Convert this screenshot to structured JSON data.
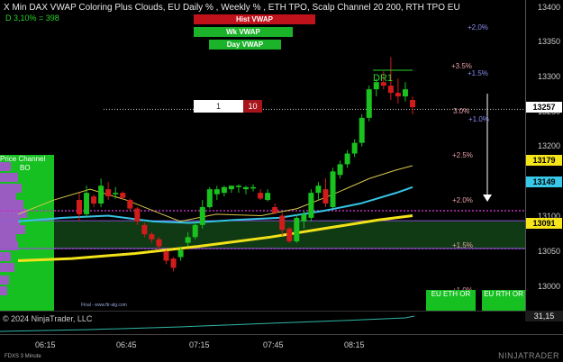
{
  "header": {
    "title": "X Min DAX VWAP Coloring Plus Clouds, EU Daily % , Weekly % , ETH TPO, Scalp Channel 20  200, RTH TPO EU",
    "d_line": "D 3,10% = 398"
  },
  "vwap_buttons": {
    "hist": "Hist VWAP",
    "wk": "Wk VWAP",
    "day": "Day VWAP"
  },
  "percent_labels": [
    {
      "text": "+2,0%",
      "color": "blue"
    },
    {
      "text": "+3.5%",
      "color": "pink"
    },
    {
      "text": "+1.5%",
      "color": "blue"
    },
    {
      "text": "3.0%",
      "color": "pink"
    },
    {
      "text": "+1.0%",
      "color": "blue"
    },
    {
      "text": "+2.5%",
      "color": "pink"
    },
    {
      "text": "+2.0%",
      "color": "pink"
    },
    {
      "text": "+1.5%",
      "color": "pink"
    },
    {
      "text": "+1.0%",
      "color": "pink"
    }
  ],
  "order": {
    "quantity": "1",
    "price_offset": "10"
  },
  "volume_profile": {
    "label": "Price Channel",
    "sub": "BO"
  },
  "dr_label": "DR1",
  "eu_or": {
    "eth": "EU ETH OR",
    "rth": "EU RTH OR"
  },
  "copyright": "Final - www.ftr-alg.com",
  "price_axis": {
    "ticks": [
      "13400",
      "13350",
      "13300",
      "13250",
      "13200",
      "13150",
      "13100",
      "13050",
      "13000"
    ],
    "tags": [
      {
        "text": "13257",
        "bg": "#ffffff"
      },
      {
        "text": "13179",
        "bg": "#f5e51a"
      },
      {
        "text": "13149",
        "bg": "#39c9e8"
      },
      {
        "text": "13091",
        "bg": "#f5e51a"
      }
    ]
  },
  "oscillator": {
    "label": "© 2024 NinjaTrader, LLC",
    "value": "31,15"
  },
  "time_axis": [
    "06:15",
    "06:45",
    "07:15",
    "07:45",
    "08:15"
  ],
  "footer": {
    "instrument": "FDXS 3 Minute",
    "logo": "NINJATRADER"
  },
  "colors": {
    "up": "#19c21e",
    "down": "#d21c1c",
    "yellow": "#f2e21a",
    "cyan": "#35c4e6",
    "magenta": "#c030c0",
    "cloud": "#0f3a14"
  },
  "chart_data": {
    "type": "candlestick",
    "ylim": [
      12975,
      13410
    ],
    "candles": [
      {
        "o": 13130,
        "h": 13140,
        "l": 13100,
        "c": 13110
      },
      {
        "o": 13110,
        "h": 13150,
        "l": 13105,
        "c": 13140
      },
      {
        "o": 13135,
        "h": 13138,
        "l": 13120,
        "c": 13125
      },
      {
        "o": 13125,
        "h": 13160,
        "l": 13120,
        "c": 13150
      },
      {
        "o": 13145,
        "h": 13155,
        "l": 13130,
        "c": 13135
      },
      {
        "o": 13138,
        "h": 13148,
        "l": 13132,
        "c": 13140
      },
      {
        "o": 13140,
        "h": 13142,
        "l": 13130,
        "c": 13133
      },
      {
        "o": 13130,
        "h": 13132,
        "l": 13115,
        "c": 13118
      },
      {
        "o": 13118,
        "h": 13120,
        "l": 13095,
        "c": 13100
      },
      {
        "o": 13095,
        "h": 13098,
        "l": 13078,
        "c": 13082
      },
      {
        "o": 13082,
        "h": 13085,
        "l": 13070,
        "c": 13075
      },
      {
        "o": 13075,
        "h": 13078,
        "l": 13060,
        "c": 13065
      },
      {
        "o": 13058,
        "h": 13060,
        "l": 13040,
        "c": 13045
      },
      {
        "o": 13048,
        "h": 13050,
        "l": 13030,
        "c": 13035
      },
      {
        "o": 13050,
        "h": 13065,
        "l": 13045,
        "c": 13060
      },
      {
        "o": 13070,
        "h": 13085,
        "l": 13065,
        "c": 13078
      },
      {
        "o": 13078,
        "h": 13100,
        "l": 13075,
        "c": 13095
      },
      {
        "o": 13095,
        "h": 13130,
        "l": 13090,
        "c": 13120
      },
      {
        "o": 13120,
        "h": 13148,
        "l": 13118,
        "c": 13145
      },
      {
        "o": 13138,
        "h": 13150,
        "l": 13130,
        "c": 13145
      },
      {
        "o": 13140,
        "h": 13150,
        "l": 13135,
        "c": 13148
      },
      {
        "o": 13145,
        "h": 13150,
        "l": 13140,
        "c": 13150
      },
      {
        "o": 13148,
        "h": 13152,
        "l": 13140,
        "c": 13150
      },
      {
        "o": 13145,
        "h": 13150,
        "l": 13138,
        "c": 13148
      },
      {
        "o": 13146,
        "h": 13152,
        "l": 13142,
        "c": 13148
      },
      {
        "o": 13140,
        "h": 13145,
        "l": 13130,
        "c": 13132
      },
      {
        "o": 13130,
        "h": 13145,
        "l": 13128,
        "c": 13140
      },
      {
        "o": 13120,
        "h": 13125,
        "l": 13110,
        "c": 13112
      },
      {
        "o": 13108,
        "h": 13112,
        "l": 13080,
        "c": 13088
      },
      {
        "o": 13090,
        "h": 13092,
        "l": 13070,
        "c": 13072
      },
      {
        "o": 13072,
        "h": 13110,
        "l": 13070,
        "c": 13105
      },
      {
        "o": 13100,
        "h": 13115,
        "l": 13090,
        "c": 13110
      },
      {
        "o": 13105,
        "h": 13145,
        "l": 13100,
        "c": 13140
      },
      {
        "o": 13140,
        "h": 13155,
        "l": 13130,
        "c": 13150
      },
      {
        "o": 13145,
        "h": 13160,
        "l": 13120,
        "c": 13125
      },
      {
        "o": 13120,
        "h": 13175,
        "l": 13118,
        "c": 13170
      },
      {
        "o": 13165,
        "h": 13185,
        "l": 13160,
        "c": 13180
      },
      {
        "o": 13180,
        "h": 13200,
        "l": 13175,
        "c": 13195
      },
      {
        "o": 13195,
        "h": 13215,
        "l": 13190,
        "c": 13210
      },
      {
        "o": 13210,
        "h": 13250,
        "l": 13205,
        "c": 13245
      },
      {
        "o": 13245,
        "h": 13290,
        "l": 13240,
        "c": 13285
      },
      {
        "o": 13285,
        "h": 13300,
        "l": 13275,
        "c": 13295
      },
      {
        "o": 13295,
        "h": 13310,
        "l": 13285,
        "c": 13290
      },
      {
        "o": 13290,
        "h": 13330,
        "l": 13270,
        "c": 13280
      },
      {
        "o": 13280,
        "h": 13300,
        "l": 13265,
        "c": 13275
      },
      {
        "o": 13275,
        "h": 13295,
        "l": 13268,
        "c": 13285
      },
      {
        "o": 13270,
        "h": 13275,
        "l": 13250,
        "c": 13260
      }
    ],
    "levels": {
      "last": 13257,
      "magenta": [
        13115,
        13062
      ],
      "cloud_band": [
        13100,
        13062
      ]
    }
  }
}
